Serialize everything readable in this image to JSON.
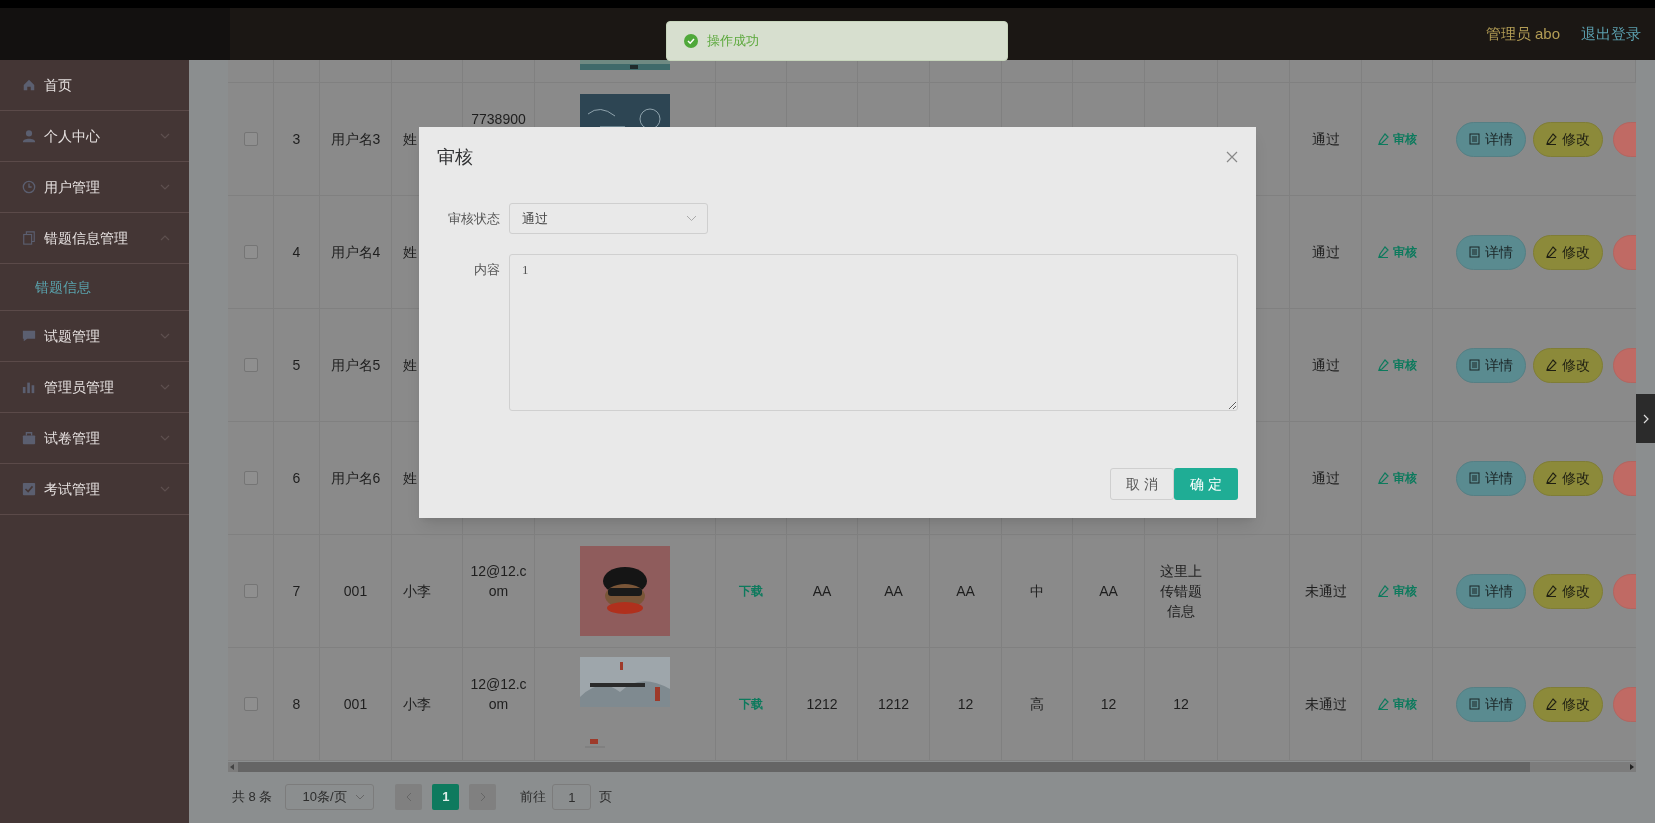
{
  "header": {
    "user": "管理员 abo",
    "logout": "退出登录"
  },
  "toast": {
    "kind": "success",
    "message": "操作成功"
  },
  "sidebar": {
    "items": [
      {
        "label": "首页",
        "kind": "link"
      },
      {
        "label": "个人中心",
        "kind": "submenu",
        "expanded": false
      },
      {
        "label": "用户管理",
        "kind": "submenu",
        "expanded": false
      },
      {
        "label": "错题信息管理",
        "kind": "submenu",
        "expanded": true,
        "children": [
          {
            "label": "错题信息",
            "selected": true
          }
        ]
      },
      {
        "label": "试题管理",
        "kind": "submenu",
        "expanded": false
      },
      {
        "label": "管理员管理",
        "kind": "submenu",
        "expanded": false
      },
      {
        "label": "试卷管理",
        "kind": "submenu",
        "expanded": false
      },
      {
        "label": "考试管理",
        "kind": "submenu",
        "expanded": false
      }
    ]
  },
  "table": {
    "rows": [
      {
        "checked": false,
        "index": "3",
        "username": "用户名3",
        "name": "姓",
        "email": "7738900",
        "status": "通过",
        "audit": "审核",
        "actions": [
          {
            "kind": "detail",
            "label": "详情"
          },
          {
            "kind": "edit",
            "label": "修改"
          },
          {
            "kind": "danger"
          }
        ]
      },
      {
        "checked": false,
        "index": "4",
        "username": "用户名4",
        "name": "姓",
        "status": "通过",
        "audit": "审核",
        "actions": [
          {
            "kind": "detail",
            "label": "详情"
          },
          {
            "kind": "edit",
            "label": "修改"
          },
          {
            "kind": "danger"
          }
        ]
      },
      {
        "checked": false,
        "index": "5",
        "username": "用户名5",
        "name": "姓",
        "status": "通过",
        "audit": "审核",
        "actions": [
          {
            "kind": "detail",
            "label": "详情"
          },
          {
            "kind": "edit",
            "label": "修改"
          },
          {
            "kind": "danger"
          }
        ]
      },
      {
        "checked": false,
        "index": "6",
        "username": "用户名6",
        "name": "姓",
        "status": "通过",
        "audit": "审核",
        "actions": [
          {
            "kind": "detail",
            "label": "详情"
          },
          {
            "kind": "edit",
            "label": "修改"
          },
          {
            "kind": "danger"
          }
        ]
      },
      {
        "checked": false,
        "index": "7",
        "username": "001",
        "name": "小李",
        "email": "12@12.com",
        "download": "下载",
        "subject": "AA",
        "type": "AA",
        "knowledge_point": "AA",
        "difficulty": "中",
        "error_reason": "AA",
        "solution": "这里上传错题信息",
        "status": "未通过",
        "audit": "审核",
        "actions": [
          {
            "kind": "detail",
            "label": "详情"
          },
          {
            "kind": "edit",
            "label": "修改"
          },
          {
            "kind": "danger"
          }
        ]
      },
      {
        "checked": false,
        "index": "8",
        "username": "001",
        "name": "小李",
        "email": "12@12.com",
        "download": "下载",
        "subject": "1212",
        "type": "1212",
        "knowledge_point": "12",
        "difficulty": "高",
        "error_reason": "12",
        "solution": "12",
        "status": "未通过",
        "audit": "审核",
        "actions": [
          {
            "kind": "detail",
            "label": "详情"
          },
          {
            "kind": "edit",
            "label": "修改"
          },
          {
            "kind": "danger"
          }
        ]
      }
    ]
  },
  "pagination": {
    "total": "共 8 条",
    "page_size": "10条/页",
    "pages": [
      {
        "label": "1",
        "selected": true
      }
    ],
    "goto_label": "前往",
    "goto_value": "1",
    "goto_suffix": "页"
  },
  "dialog": {
    "title": "审核",
    "fields": [
      {
        "kind": "select",
        "label": "审核状态",
        "value": "通过"
      },
      {
        "kind": "textarea",
        "label": "内容",
        "value": "1"
      }
    ],
    "buttons": [
      {
        "kind": "default",
        "label": "取消"
      },
      {
        "kind": "primary",
        "label": "确定"
      }
    ]
  }
}
